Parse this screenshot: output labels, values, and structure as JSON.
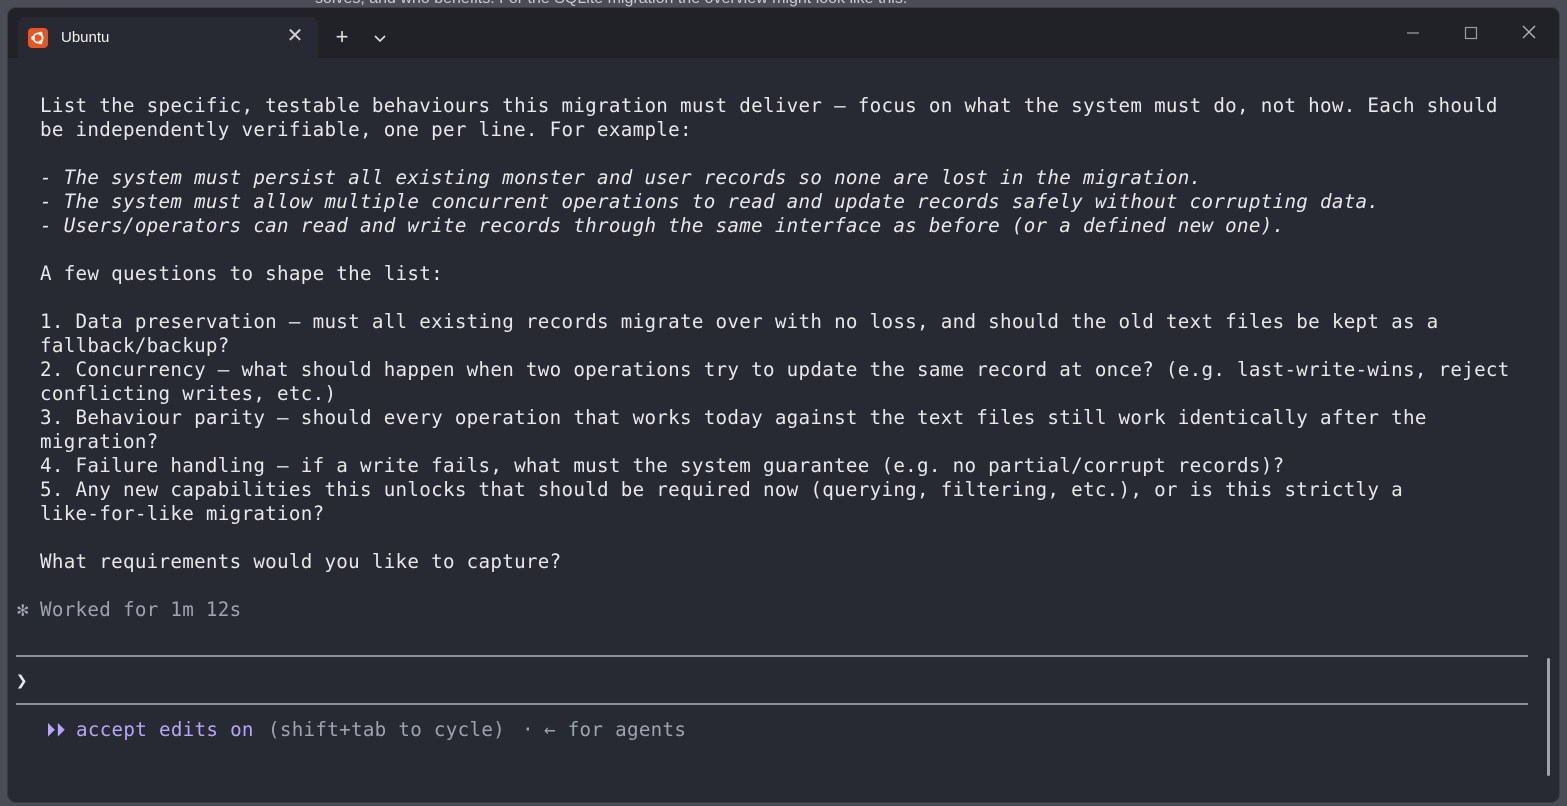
{
  "background": {
    "behind_text": "solves, and who benefits. For the SQLite migration the overview might look like this:"
  },
  "window": {
    "tab_title": "Ubuntu",
    "tab_close_label": "✕",
    "new_tab_label": "+",
    "brand_color": "#e95420"
  },
  "terminal": {
    "intro_lines": [
      "List the specific, testable behaviours this migration must deliver — focus on what the system must do, not how. Each should",
      "be independently verifiable, one per line. For example:"
    ],
    "examples": [
      "- The system must persist all existing monster and user records so none are lost in the migration.",
      "- The system must allow multiple concurrent operations to read and update records safely without corrupting data.",
      "- Users/operators can read and write records through the same interface as before (or a defined new one)."
    ],
    "questions_heading": "A few questions to shape the list:",
    "question_lines": [
      "1. Data preservation — must all existing records migrate over with no loss, and should the old text files be kept as a",
      "fallback/backup?",
      "2. Concurrency — what should happen when two operations try to update the same record at once? (e.g. last-write-wins, reject",
      "conflicting writes, etc.)",
      "3. Behaviour parity — should every operation that works today against the text files still work identically after the",
      "migration?",
      "4. Failure handling — if a write fails, what must the system guarantee (e.g. no partial/corrupt records)?",
      "5. Any new capabilities this unlocks that should be required now (querying, filtering, etc.), or is this strictly a",
      "like-for-like migration?"
    ],
    "closing_question": "What requirements would you like to capture?",
    "status_glyph": "✻",
    "status_text": "Worked for 1m 12s",
    "prompt_glyph": "❯",
    "prompt_value": "",
    "mode": {
      "glyph": "⏵⏵",
      "label": "accept edits on",
      "hint": "(shift+tab to cycle)",
      "separator": "·",
      "agents_hint": "← for agents",
      "accent_color": "#b7a6f5"
    }
  }
}
